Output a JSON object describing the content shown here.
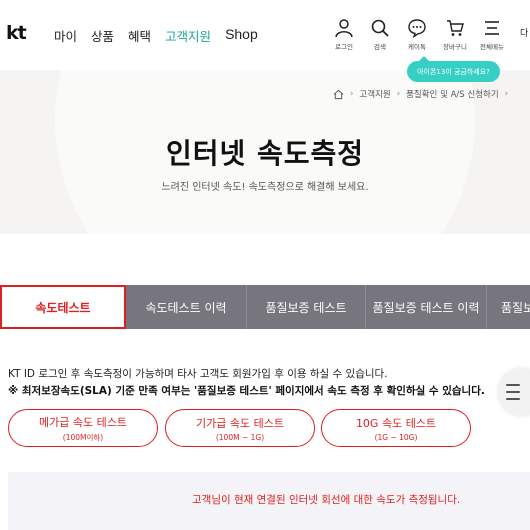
{
  "header": {
    "logo": "kt",
    "nav": [
      "마이",
      "상품",
      "혜택",
      "고객지원",
      "Shop"
    ],
    "active_nav": "고객지원",
    "utilities": [
      {
        "label": "로그인",
        "icon": "user-icon"
      },
      {
        "label": "검색",
        "icon": "search-icon"
      },
      {
        "label": "케이톡",
        "icon": "chat-icon"
      },
      {
        "label": "장바구니",
        "icon": "cart-icon"
      },
      {
        "label": "전체메뉴",
        "icon": "menu-icon"
      }
    ],
    "more_label": "다",
    "tooltip": "아이폰13이 궁금하세요?"
  },
  "breadcrumb": [
    "고객지원",
    "품질확인 및 A/S 신청하기"
  ],
  "hero": {
    "title": "인터넷 속도측정",
    "subtitle": "느려진 인터넷 속도! 속도측정으로 해결해 보세요."
  },
  "tabs": [
    "속도테스트",
    "속도테스트 이력",
    "품질보증 테스트",
    "품질보증 테스트 이력",
    "품질보"
  ],
  "notice": {
    "line1": "KT ID 로그인 후 속도측정이 가능하며 타사 고객도 회원가입 후 이용 하실 수 있습니다.",
    "line2": "※ 최저보장속도(SLA) 기준 만족 여부는 '품질보증 테스트' 페이지에서 속도 측정 후 확인하실 수 있습니다."
  },
  "speed_tests": [
    {
      "name": "메가급 속도 테스트",
      "range": "(100M이하)"
    },
    {
      "name": "기가급 속도 테스트",
      "range": "(100M ~ 1G)"
    },
    {
      "name": "10G 속도 테스트",
      "range": "(1G ~ 10G)"
    }
  ],
  "info_message": "고객님이 현재 연결된 인터넷 회선에 대한 속도가 측정됩니다.",
  "colors": {
    "accent": "#e02020",
    "teal": "#1aa39a",
    "tab_bg": "#77767e",
    "tooltip": "#36cfc4"
  }
}
